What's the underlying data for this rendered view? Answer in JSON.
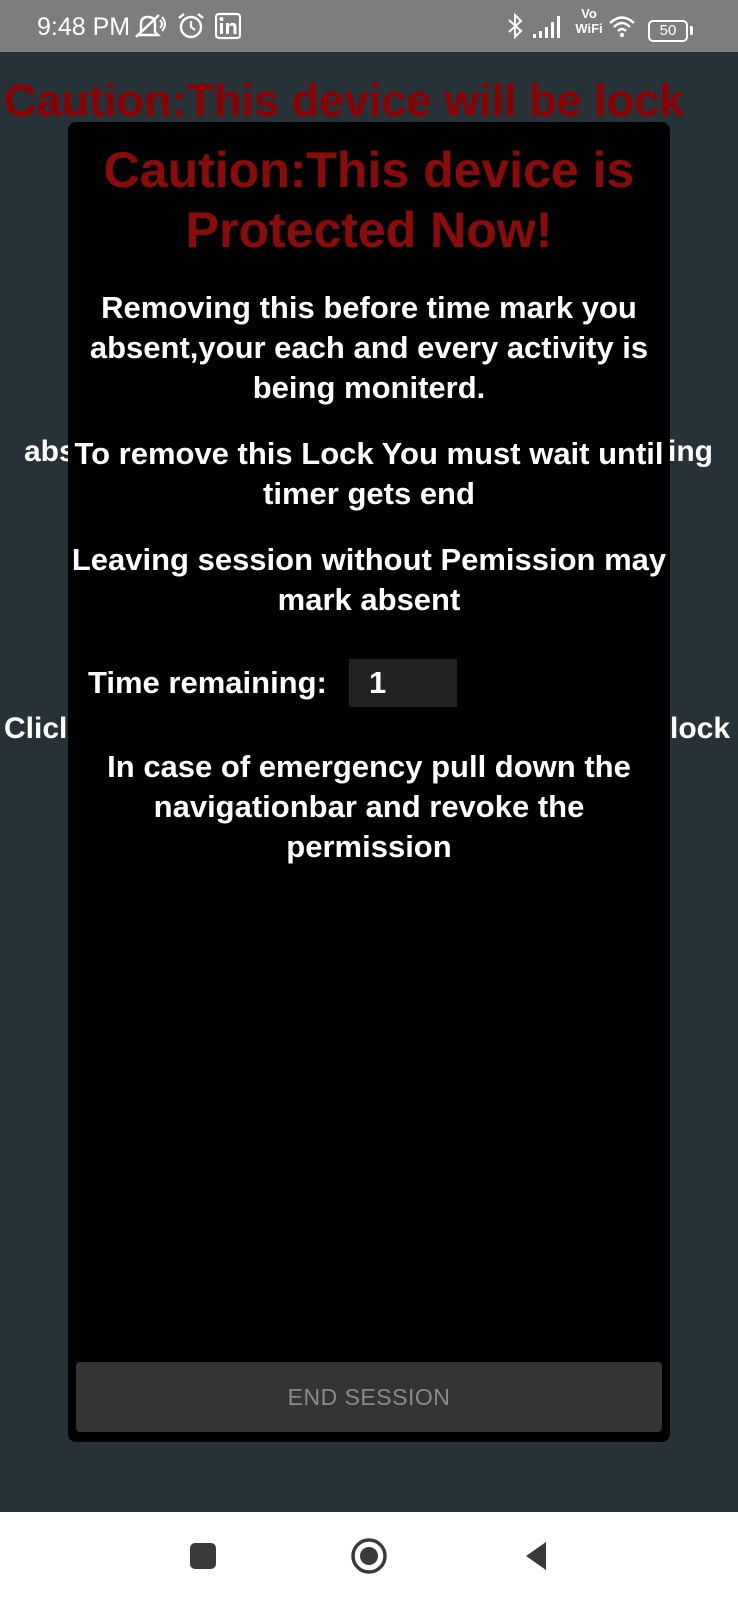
{
  "status_bar": {
    "time": "9:48 PM",
    "network_label": "Vo\nWiFi",
    "battery": "50",
    "icons": [
      "mute-icon",
      "alarm-icon",
      "linkedin-icon",
      "bluetooth-icon",
      "signal-icon",
      "wifi-icon",
      "battery-icon"
    ]
  },
  "background_screen": {
    "heading": "Caution:This device will be lock",
    "fragment_left_1": "abs",
    "fragment_right_1": "ing",
    "fragment_left_2": "Clicl",
    "fragment_right_2": "lock"
  },
  "dialog": {
    "title": "Caution:This device is Protected Now!",
    "message_monitor": "Removing this before time mark you absent,your each and every activity is being moniterd.",
    "message_timer": "To remove this Lock You must wait until timer gets end",
    "message_leaving": "Leaving session without Pemission may mark absent",
    "time_label": "Time remaining:",
    "time_value": "1",
    "message_emergency": "In case of emergency pull down the navigationbar and revoke the permission",
    "end_button_label": "END SESSION"
  },
  "nav_bar": {
    "buttons": [
      "recents-icon",
      "home-icon",
      "back-icon"
    ]
  },
  "colors": {
    "status_bar_bg": "#7d7d7d",
    "screen_bg": "#263238",
    "dialog_bg": "#000000",
    "caution_red": "#8b0a0a",
    "button_bg": "#343434",
    "button_text": "#8a8a8a",
    "nav_bar_bg": "#ffffff"
  }
}
